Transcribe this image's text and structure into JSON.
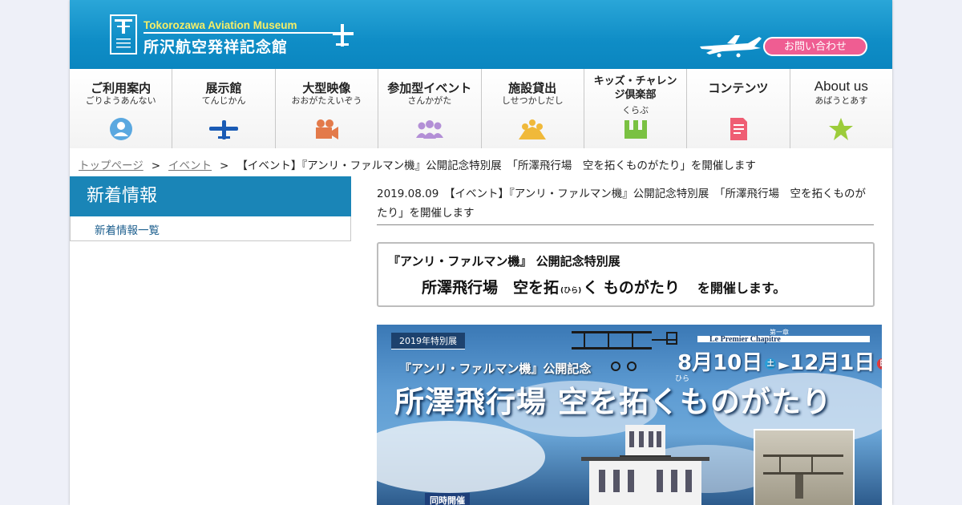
{
  "header": {
    "logo_en": "Tokorozawa Aviation Museum",
    "logo_ja": "所沢航空発祥記念館",
    "contact_label": "お問い合わせ"
  },
  "nav": [
    {
      "title": "ご利用案内",
      "sub": "ごりようあんない",
      "icon": "user-icon",
      "color": "#5aa8e0"
    },
    {
      "title": "展示館",
      "sub": "てんじかん",
      "icon": "airplane-icon",
      "color": "#1a5bb5"
    },
    {
      "title": "大型映像",
      "sub": "おおがたえいぞう",
      "icon": "video-camera-icon",
      "color": "#e37a4a"
    },
    {
      "title": "参加型イベント",
      "sub": "さんかがた",
      "icon": "group-icon",
      "color": "#b38fd6"
    },
    {
      "title": "施設貸出",
      "sub": "しせつかしだし",
      "icon": "people-crowd-icon",
      "color": "#f0b93a"
    },
    {
      "title": "キッズ・チャレンジ倶楽部",
      "sub": "くらぶ",
      "icon": "crown-icon",
      "color": "#7ac142"
    },
    {
      "title": "コンテンツ",
      "sub": "",
      "icon": "document-icon",
      "color": "#ef5d73"
    },
    {
      "title": "About us",
      "sub": "あばうとあす",
      "icon": "star-icon",
      "color": "#9ccc3a"
    }
  ],
  "breadcrumb": {
    "home": "トップページ",
    "events": "イベント",
    "separator": ">",
    "current": "【イベント】『アンリ・ファルマン機』公開記念特別展　「所澤飛行場　空を拓くものがたり」を開催します"
  },
  "sidebar": {
    "heading": "新着情報",
    "link": "新着情報一覧"
  },
  "post": {
    "title": "2019.08.09　【イベント】『アンリ・ファルマン機』公開記念特別展　「所澤飛行場　空を拓くものがたり」を開催します"
  },
  "notice": {
    "line1": "『アンリ・ファルマン機』 公開記念特別展",
    "line2_main": "所澤飛行場　空を拓",
    "line2_ruby": "(ひら)",
    "line2_rest": "く ものがたり",
    "line2_tail": "を開催します。"
  },
  "poster": {
    "year_label": "2019年特別展",
    "subtitle": "『アンリ・ファルマン機』公開記念",
    "main_title": "所澤飛行場 空を拓くものがたり",
    "ruby": "ひら",
    "chapter_jp": "第一章",
    "chapter": "Le Premier Chapitre",
    "date_start": "8月10日",
    "start_day": "土",
    "arrow": "►",
    "date_end": "12月1日",
    "end_day": "日",
    "concurrent": "同時開催"
  }
}
